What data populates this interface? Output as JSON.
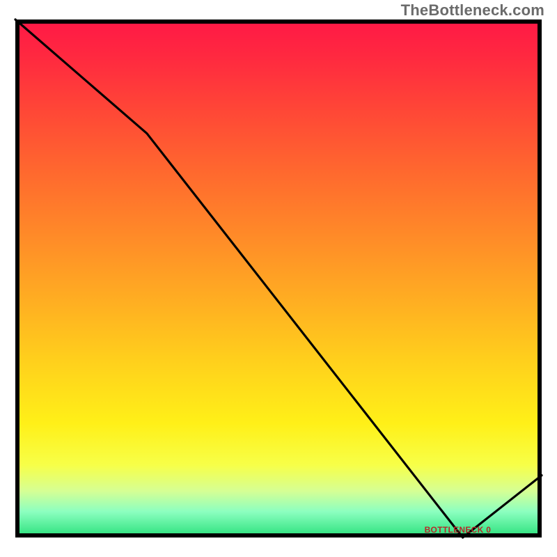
{
  "watermark": "TheBottleneck.com",
  "bottom_caption": "BOTTLENECK 0",
  "chart_data": {
    "type": "line",
    "title": "",
    "xlabel": "",
    "ylabel": "",
    "xlim": [
      0,
      100
    ],
    "ylim": [
      0,
      100
    ],
    "x": [
      0,
      25,
      85,
      100
    ],
    "y": [
      100,
      78,
      0,
      12
    ],
    "notes": "Background is a vertical gradient from red (top, high bottleneck) through orange/yellow to green (bottom, zero bottleneck). The black curve descends from top-left, kinks near x≈25, reaches the bottom near x≈85, then rises toward x=100. A small red caption 'BOTTLENECK 0' sits on the x-axis near the minimum."
  },
  "colors": {
    "frame": "#000000",
    "line": "#000000",
    "caption": "#b52a2a",
    "watermark": "#6b6b6b"
  }
}
